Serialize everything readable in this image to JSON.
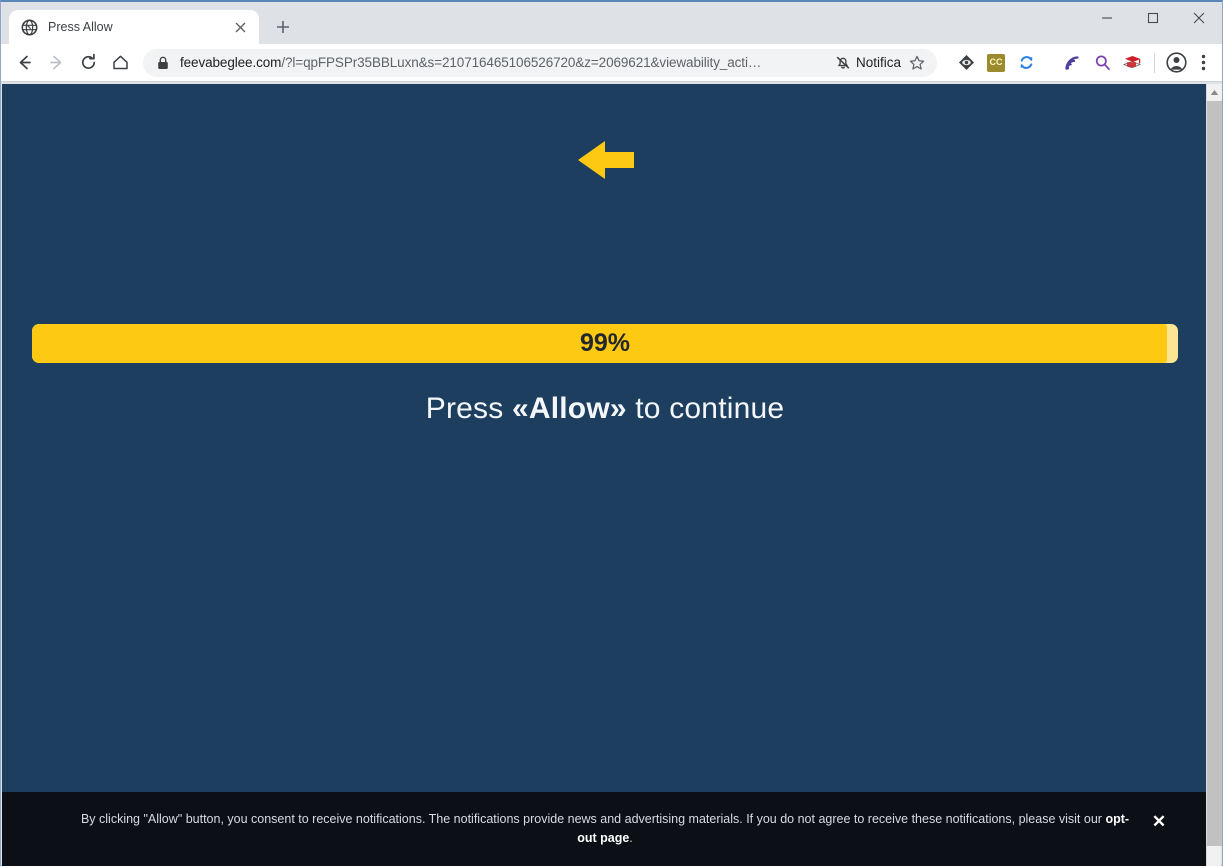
{
  "window": {
    "minimize_label": "Minimize",
    "maximize_label": "Maximize",
    "close_label": "Close"
  },
  "tabs": [
    {
      "title": "Press Allow",
      "favicon": "globe-icon",
      "close_label": "×"
    }
  ],
  "newtab_label": "+",
  "toolbar": {
    "back_label": "Back",
    "forward_label": "Forward",
    "reload_label": "Reload",
    "home_label": "Home",
    "lock_icon": "lock-icon",
    "url_host": "feevabeglee.com",
    "url_path": "/?l=qpFPSPr35BBLuxn&s=210716465106526720&z=2069621&viewability_acti…",
    "notifications_blocked_label": "Notifica",
    "bookmark_label": "Bookmark this page",
    "extensions": [
      {
        "name": "diamond-eye-extension-icon",
        "badge": ""
      },
      {
        "name": "cc-extension-icon",
        "badge": "CC"
      },
      {
        "name": "sync-extension-icon",
        "badge": ""
      },
      {
        "name": "rss-feed-extension-icon",
        "badge": ""
      },
      {
        "name": "search-extension-icon",
        "badge": ""
      },
      {
        "name": "graduation-cap-extension-icon",
        "badge": ""
      }
    ],
    "profile_label": "Profile",
    "menu_label": "Customize and control"
  },
  "page": {
    "background_color": "#1e3e5f",
    "arrow": {
      "direction": "left",
      "color": "#fdc913"
    },
    "progress": {
      "percent_label": "99%",
      "percent_value": 99,
      "fill_color": "#fdc913",
      "track_color": "#fce694",
      "text_color": "#23282d"
    },
    "headline": {
      "prefix": "Press ",
      "emphasis": "«Allow»",
      "suffix": " to continue"
    },
    "consent": {
      "text_before_link": "By clicking \"Allow\" button, you consent to receive notifications. The notifications provide news and advertising materials. If you do not agree to receive these notifications, please visit our ",
      "link_text": "opt-out page",
      "text_after_link": ".",
      "close_label": "✕",
      "background_color": "#0c1016"
    }
  },
  "scrollbar": {
    "up_arrow_label": "Scroll up"
  }
}
